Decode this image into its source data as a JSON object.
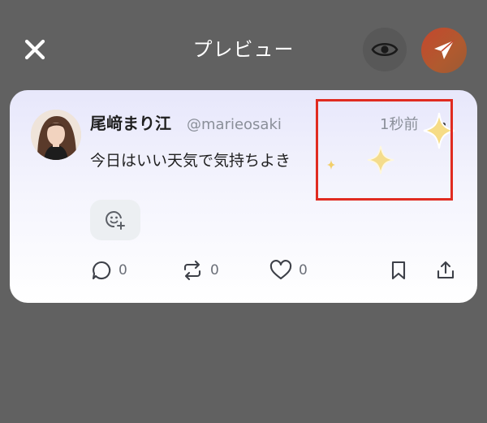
{
  "header": {
    "title": "プレビュー",
    "close_icon": "close-icon",
    "preview_icon": "eye-icon",
    "send_icon": "paper-plane-icon"
  },
  "post": {
    "display_name": "尾﨑まり江",
    "handle": "@marieosaki",
    "time": "1秒前",
    "text": "今日はいい天気で気持ちよき",
    "reaction_icon": "add-emoji-icon",
    "actions": {
      "reply_count": "0",
      "repost_count": "0",
      "like_count": "0"
    }
  },
  "colors": {
    "overlay": "#616161",
    "card_top": "#e7e7fb",
    "highlight_box": "#e02b20",
    "send_button": "#c5472e",
    "sparkle": "#f3d77a"
  }
}
